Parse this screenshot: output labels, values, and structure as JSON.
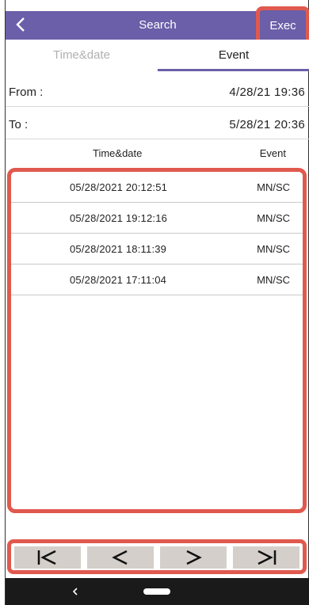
{
  "appbar": {
    "title": "Search",
    "exec_label": "Exec"
  },
  "tabs": [
    {
      "label": "Time&date"
    },
    {
      "label": "Event"
    }
  ],
  "range": {
    "from_label": "From :",
    "from_value": "4/28/21  19:36",
    "to_label": "To :",
    "to_value": "5/28/21  20:36"
  },
  "table": {
    "headers": [
      "Time&date",
      "Event"
    ],
    "rows": [
      {
        "datetime": "05/28/2021  20:12:51",
        "event": "MN/SC"
      },
      {
        "datetime": "05/28/2021  19:12:16",
        "event": "MN/SC"
      },
      {
        "datetime": "05/28/2021  18:11:39",
        "event": "MN/SC"
      },
      {
        "datetime": "05/28/2021  17:11:04",
        "event": "MN/SC"
      }
    ]
  },
  "pager": {
    "icons": [
      "first-page-icon",
      "previous-page-icon",
      "next-page-icon",
      "last-page-icon"
    ]
  },
  "colors": {
    "accent": "#6a5fa8",
    "highlight": "#e0594e",
    "button_bg": "#d4cfca",
    "system_bar": "#1a1a1a"
  }
}
